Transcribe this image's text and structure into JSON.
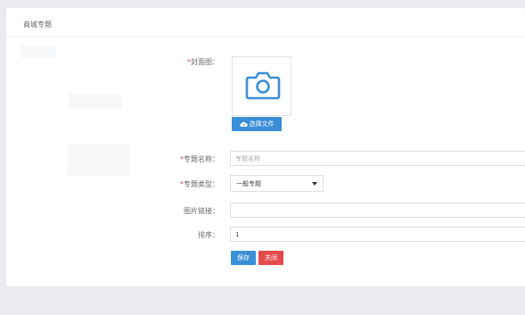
{
  "panel": {
    "title": "商城专题"
  },
  "form": {
    "cover": {
      "label": "封面图：",
      "required_mark": "*",
      "upload_label": "选择文件"
    },
    "name": {
      "label": "专题名称：",
      "required_mark": "*",
      "placeholder": "专题名称",
      "value": ""
    },
    "type": {
      "label": "专题类型：",
      "required_mark": "*",
      "selected": "一般专题"
    },
    "link": {
      "label": "图片链接：",
      "value": ""
    },
    "sort": {
      "label": "排序：",
      "value": "1"
    }
  },
  "actions": {
    "save_label": "保存",
    "close_label": "关闭"
  },
  "colors": {
    "primary": "#3a8fd6",
    "danger": "#e54a4a",
    "required": "#e04848"
  },
  "icons": {
    "cover_placeholder": "camera-icon",
    "upload": "cloud-upload-icon",
    "dropdown": "caret-down-icon"
  }
}
